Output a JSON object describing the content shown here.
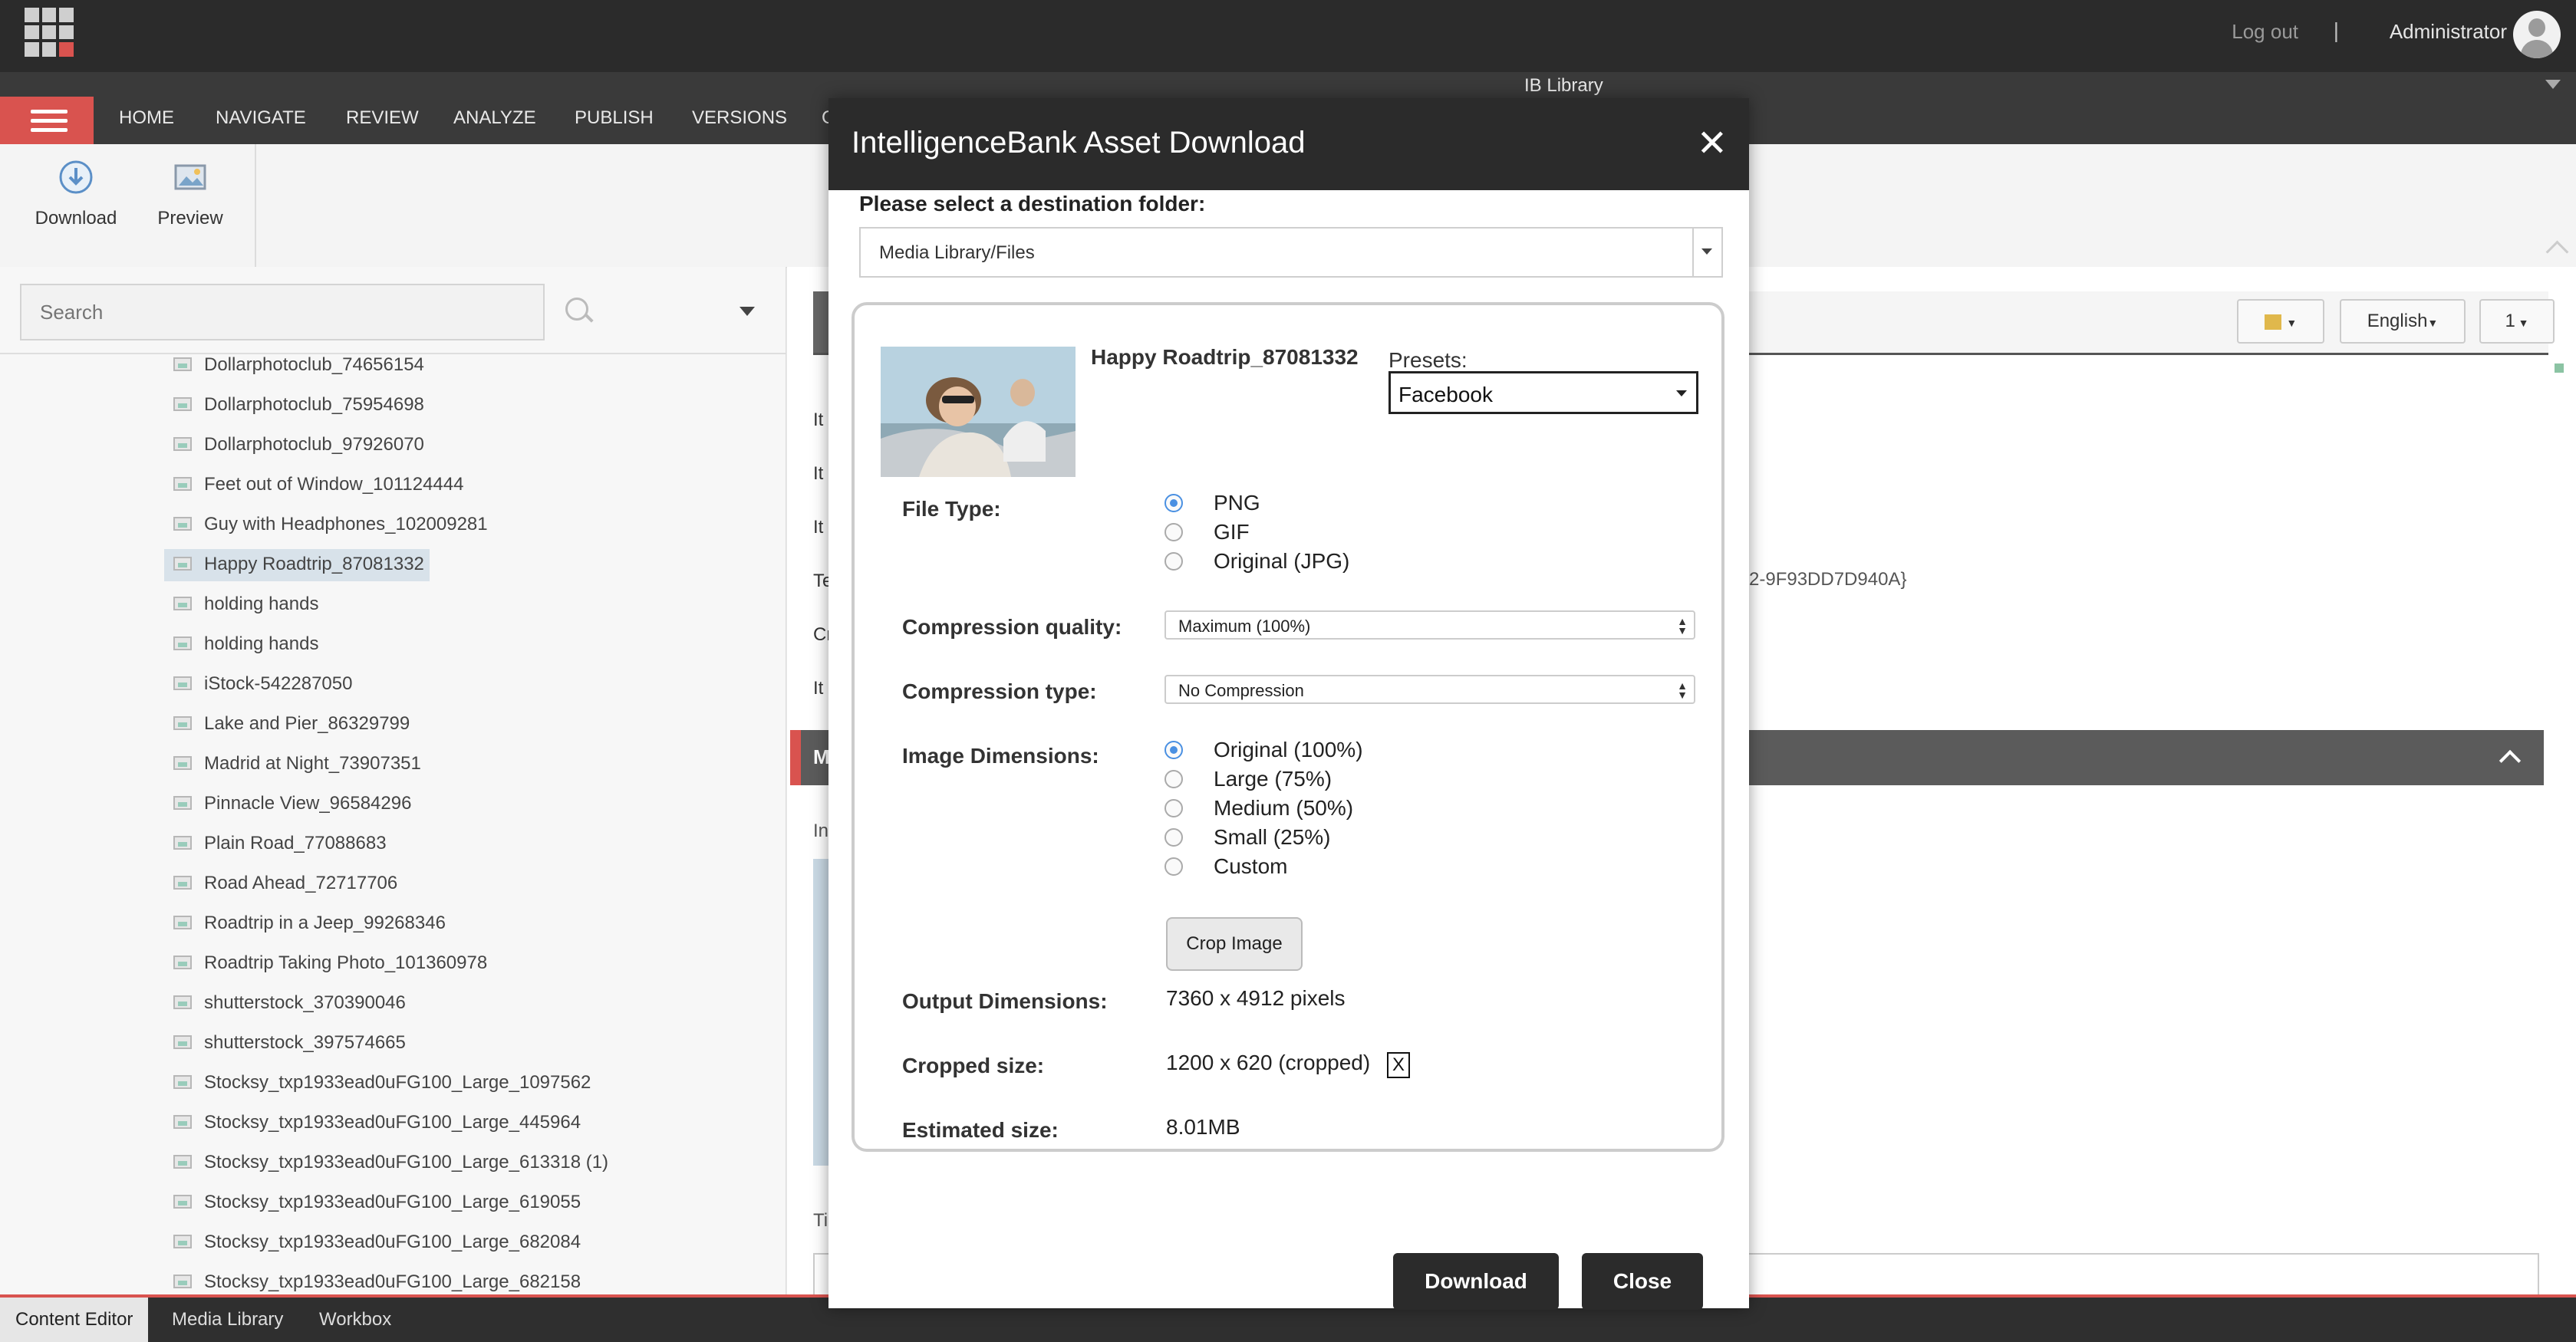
{
  "header": {
    "logout": "Log out",
    "separator": "|",
    "user": "Administrator",
    "library": "IB Library"
  },
  "nav_tabs": [
    "HOME",
    "NAVIGATE",
    "REVIEW",
    "ANALYZE",
    "PUBLISH",
    "VERSIONS",
    "C"
  ],
  "ribbon": {
    "download": "Download",
    "preview": "Preview"
  },
  "search": {
    "placeholder": "Search"
  },
  "tree_items": [
    "Dollarphotoclub_74656154",
    "Dollarphotoclub_75954698",
    "Dollarphotoclub_97926070",
    "Feet out of Window_101124444",
    "Guy with Headphones_102009281",
    "Happy Roadtrip_87081332",
    "holding hands",
    "holding hands",
    "iStock-542287050",
    "Lake and Pier_86329799",
    "Madrid at Night_73907351",
    "Pinnacle View_96584296",
    "Plain Road_77088683",
    "Road Ahead_72717706",
    "Roadtrip in a Jeep_99268346",
    "Roadtrip Taking Photo_101360978",
    "shutterstock_370390046",
    "shutterstock_397574665",
    "Stocksy_txp1933ead0uFG100_Large_1097562",
    "Stocksy_txp1933ead0uFG100_Large_445964",
    "Stocksy_txp1933ead0uFG100_Large_613318 (1)",
    "Stocksy_txp1933ead0uFG100_Large_619055",
    "Stocksy_txp1933ead0uFG100_Large_682084",
    "Stocksy_txp1933ead0uFG100_Large_682158"
  ],
  "selected_tree_item": "Happy Roadtrip_87081332",
  "content": {
    "language": "English",
    "version": "1",
    "field_stubs": [
      "It",
      "It",
      "It",
      "Te",
      "Cr",
      "It"
    ],
    "guid_fragment": "2-9F93DD7D940A}",
    "section_letter": "M",
    "image_label": "In",
    "title_label": "Ti"
  },
  "bottom_tabs": [
    "Content Editor",
    "Media Library",
    "Workbox"
  ],
  "modal": {
    "title": "IntelligenceBank Asset Download",
    "close_symbol": "✕",
    "destination_label": "Please select a destination folder:",
    "destination_value": "Media Library/Files",
    "asset_name": "Happy Roadtrip_87081332",
    "presets_label": "Presets:",
    "presets_value": "Facebook",
    "file_type_label": "File Type:",
    "file_types": [
      "PNG",
      "GIF",
      "Original (JPG)"
    ],
    "file_type_selected": 0,
    "compression_quality_label": "Compression quality:",
    "compression_quality_value": "Maximum (100%)",
    "compression_type_label": "Compression type:",
    "compression_type_value": "No Compression",
    "image_dimensions_label": "Image Dimensions:",
    "image_dimensions": [
      "Original (100%)",
      "Large (75%)",
      "Medium (50%)",
      "Small (25%)",
      "Custom"
    ],
    "image_dimension_selected": 0,
    "crop_button": "Crop Image",
    "output_dimensions_label": "Output Dimensions:",
    "output_dimensions_value": "7360 x 4912 pixels",
    "cropped_size_label": "Cropped size:",
    "cropped_size_value": "1200 x 620 (cropped)",
    "cropped_clear": "X",
    "estimated_size_label": "Estimated size:",
    "estimated_size_value": "8.01MB",
    "download_button": "Download",
    "close_button": "Close"
  },
  "colors": {
    "accent_red": "#d9534f",
    "header_dark": "#2b2b2b",
    "radio_blue": "#4a90e2"
  }
}
